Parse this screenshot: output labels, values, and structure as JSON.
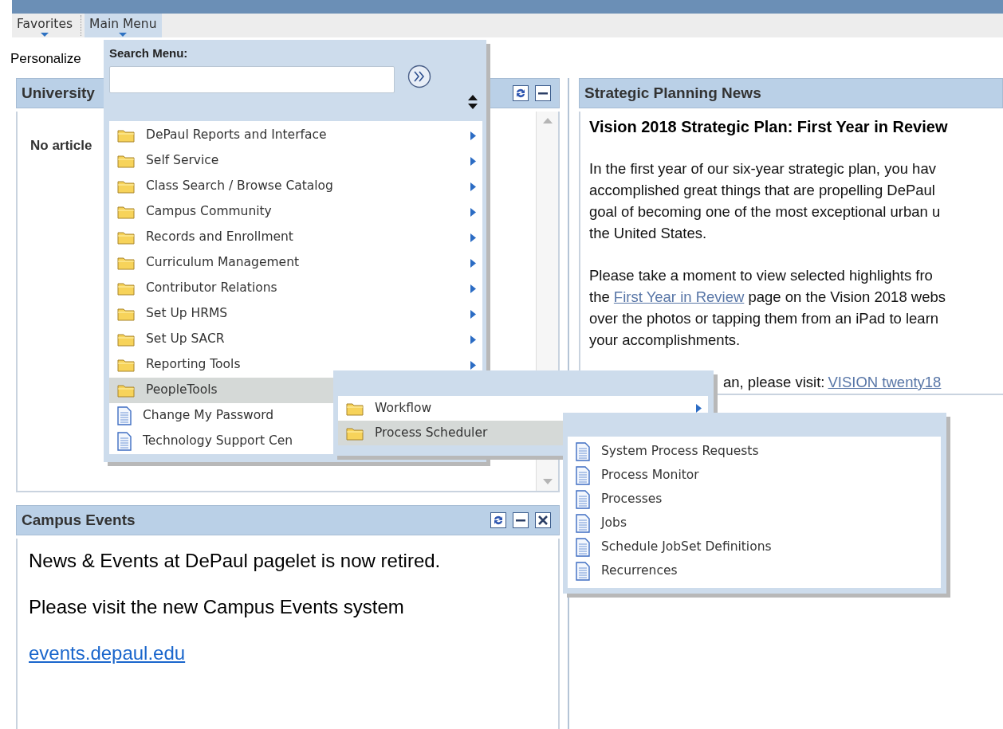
{
  "top_menu": [
    {
      "label": "Favorites",
      "selected": false
    },
    {
      "label": "Main Menu",
      "selected": true
    }
  ],
  "personalize": "Personalize",
  "university_pagelet": {
    "title": "University",
    "buttons": [
      {
        "kind": "refresh"
      },
      {
        "kind": "minimize"
      }
    ],
    "message": "No article"
  },
  "campus_events": {
    "title": "Campus Events",
    "buttons": [
      {
        "kind": "refresh"
      },
      {
        "kind": "minimize"
      },
      {
        "kind": "close"
      }
    ],
    "lines": [
      "News & Events at DePaul pagelet is now retired.",
      "Please visit the new Campus Events system"
    ],
    "link": "events.depaul.edu"
  },
  "strategic_news": {
    "title": "Strategic Planning News",
    "headline": "Vision 2018 Strategic Plan: First Year in Review",
    "paragraphs": [
      [
        [
          {
            "text": "In the first year of our six-year strategic plan, you hav"
          }
        ],
        [
          {
            "text": "accomplished great things that are propelling DePaul"
          }
        ],
        [
          {
            "text": "goal of becoming one of the most exceptional urban u"
          }
        ],
        [
          {
            "text": "the United States."
          }
        ]
      ],
      [
        [
          {
            "text": "Please take a moment to view selected highlights fro"
          }
        ],
        [
          {
            "text": "the "
          },
          {
            "text": "First Year in Review",
            "link": true
          },
          {
            "text": " page on the Vision 2018 webs"
          }
        ],
        [
          {
            "text": "over the photos or tapping them from an iPad to learn"
          }
        ],
        [
          {
            "text": "your accomplishments."
          }
        ]
      ]
    ],
    "visit_line": {
      "text": "an, please visit:",
      "link": "VISION twenty18"
    }
  },
  "main_menu": {
    "search_label": "Search Menu:",
    "items": [
      {
        "label": "DePaul Reports and Interface",
        "kind": "folder",
        "selected": false,
        "arrow": true
      },
      {
        "label": "Self Service",
        "kind": "folder",
        "selected": false,
        "arrow": true
      },
      {
        "label": "Class Search / Browse Catalog",
        "kind": "folder",
        "selected": false,
        "arrow": true
      },
      {
        "label": "Campus Community",
        "kind": "folder",
        "selected": false,
        "arrow": true
      },
      {
        "label": "Records and Enrollment",
        "kind": "folder",
        "selected": false,
        "arrow": true
      },
      {
        "label": "Curriculum Management",
        "kind": "folder",
        "selected": false,
        "arrow": true
      },
      {
        "label": "Contributor Relations",
        "kind": "folder",
        "selected": false,
        "arrow": true
      },
      {
        "label": "Set Up HRMS",
        "kind": "folder",
        "selected": false,
        "arrow": true
      },
      {
        "label": "Set Up SACR",
        "kind": "folder",
        "selected": false,
        "arrow": true
      },
      {
        "label": "Reporting Tools",
        "kind": "folder",
        "selected": false,
        "arrow": true
      },
      {
        "label": "PeopleTools",
        "kind": "folder",
        "selected": true,
        "arrow": false
      },
      {
        "label": "Change My Password",
        "kind": "page",
        "selected": false,
        "arrow": false
      },
      {
        "label": "Technology Support Cen",
        "kind": "page",
        "selected": false,
        "arrow": false
      }
    ]
  },
  "submenus": [
    {
      "items": [
        {
          "label": "Workflow",
          "kind": "folder",
          "selected": false,
          "arrow": true
        },
        {
          "label": "Process Scheduler",
          "kind": "folder",
          "selected": true,
          "arrow": false
        }
      ]
    },
    {
      "items": [
        {
          "label": "System Process Requests",
          "kind": "page",
          "selected": false,
          "arrow": false
        },
        {
          "label": "Process Monitor",
          "kind": "page",
          "selected": false,
          "arrow": false
        },
        {
          "label": "Processes",
          "kind": "page",
          "selected": false,
          "arrow": false
        },
        {
          "label": "Jobs",
          "kind": "page",
          "selected": false,
          "arrow": false
        },
        {
          "label": "Schedule JobSet Definitions",
          "kind": "page",
          "selected": false,
          "arrow": false
        },
        {
          "label": "Recurrences",
          "kind": "page",
          "selected": false,
          "arrow": false
        }
      ]
    }
  ]
}
